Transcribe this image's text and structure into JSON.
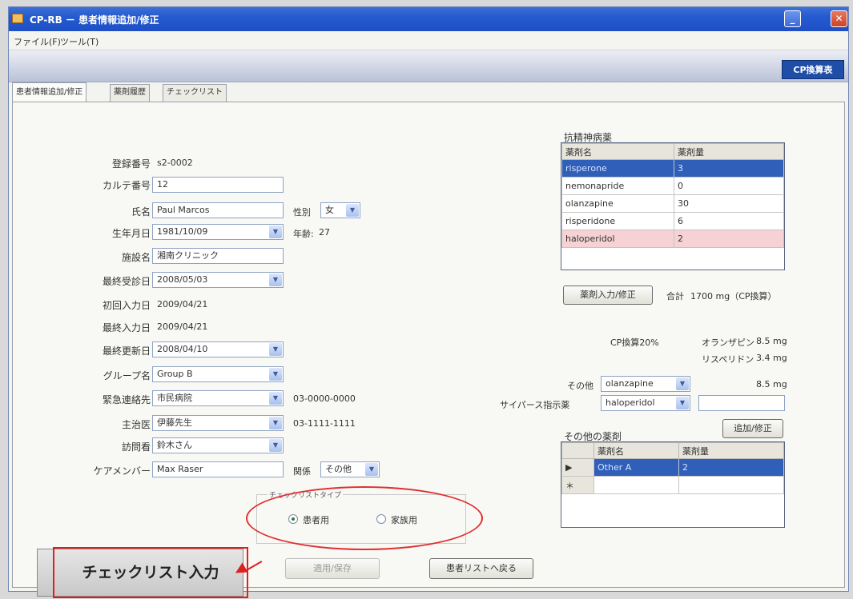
{
  "window": {
    "title": "CP-RB － 患者情報追加/修正",
    "minimize_icon": "minimize-icon",
    "close_icon": "close-icon"
  },
  "menu": [
    "ファイル(F)",
    "ツール(T)"
  ],
  "toolbar": {
    "cp_button": "CP換算表"
  },
  "tabs": [
    "患者情報追加/修正",
    "薬剤履歴",
    "チェックリスト"
  ],
  "form": {
    "reg_no": {
      "label": "登録番号",
      "value": "s2-0002"
    },
    "karte_no": {
      "label": "カルテ番号",
      "value": "12"
    },
    "name": {
      "label": "氏名",
      "value": "Paul Marcos"
    },
    "sex": {
      "label": "性別",
      "value": "女"
    },
    "birth": {
      "label": "生年月日",
      "value": "1981/10/09"
    },
    "age": {
      "label": "年齢:",
      "value": "27"
    },
    "facility": {
      "label": "施設名",
      "value": "湘南クリニック"
    },
    "last_visit": {
      "label": "最終受診日",
      "value": "2008/05/03"
    },
    "first_input": {
      "label": "初回入力日",
      "value": "2009/04/21"
    },
    "last_input": {
      "label": "最終入力日",
      "value": "2009/04/21"
    },
    "last_update": {
      "label": "最終更新日",
      "value": "2008/04/10"
    },
    "group": {
      "label": "グループ名",
      "value": "Group B"
    },
    "emergency": {
      "label": "緊急連絡先",
      "value": "市民病院",
      "phone": "03-0000-0000"
    },
    "doctor": {
      "label": "主治医",
      "value": "伊藤先生",
      "phone": "03-1111-1111"
    },
    "visiting_nurse": {
      "label": "訪問看",
      "value": "鈴木さん"
    },
    "care_member": {
      "label": "ケアメンバー",
      "value": "Max Raser"
    },
    "relation": {
      "label": "関係",
      "value": "その他"
    }
  },
  "antipsychotics": {
    "title": "抗精神病薬",
    "col_name": "薬剤名",
    "col_dose": "薬剤量",
    "rows": [
      {
        "name": "risperone",
        "dose": "3"
      },
      {
        "name": "nemonapride",
        "dose": "0"
      },
      {
        "name": "olanzapine",
        "dose": "30"
      },
      {
        "name": "risperidone",
        "dose": "6"
      },
      {
        "name": "haloperidol",
        "dose": "2"
      }
    ],
    "edit_button": "薬剤入力/修正",
    "total_label": "合計",
    "total_value": "1700 mg（CP換算）"
  },
  "cp": {
    "label": "CP換算20%",
    "line1_name": "オランザピン",
    "line1_val": "8.5 mg",
    "line2_name": "リスペリドン",
    "line2_val": "3.4 mg",
    "other_label": "その他",
    "other_value": "olanzapine",
    "other_amount": "8.5 mg",
    "cyp_label": "サイパース指示薬",
    "cyp_value": "haloperidol",
    "add_button": "追加/修正"
  },
  "other_drugs": {
    "title": "その他の薬剤",
    "col_name": "薬剤名",
    "col_dose": "薬剤量",
    "rows": [
      {
        "marker": "▶",
        "name": "Other A",
        "dose": "2"
      },
      {
        "marker": "＊",
        "name": "",
        "dose": ""
      }
    ]
  },
  "checklist_type": {
    "title": "チェックリストタイプ",
    "option1": "患者用",
    "option2": "家族用",
    "selected": "患者用"
  },
  "buttons": {
    "checklist_input": "チェックリスト入力",
    "apply_save": "適用/保存",
    "back_to_list": "患者リストへ戻る"
  }
}
